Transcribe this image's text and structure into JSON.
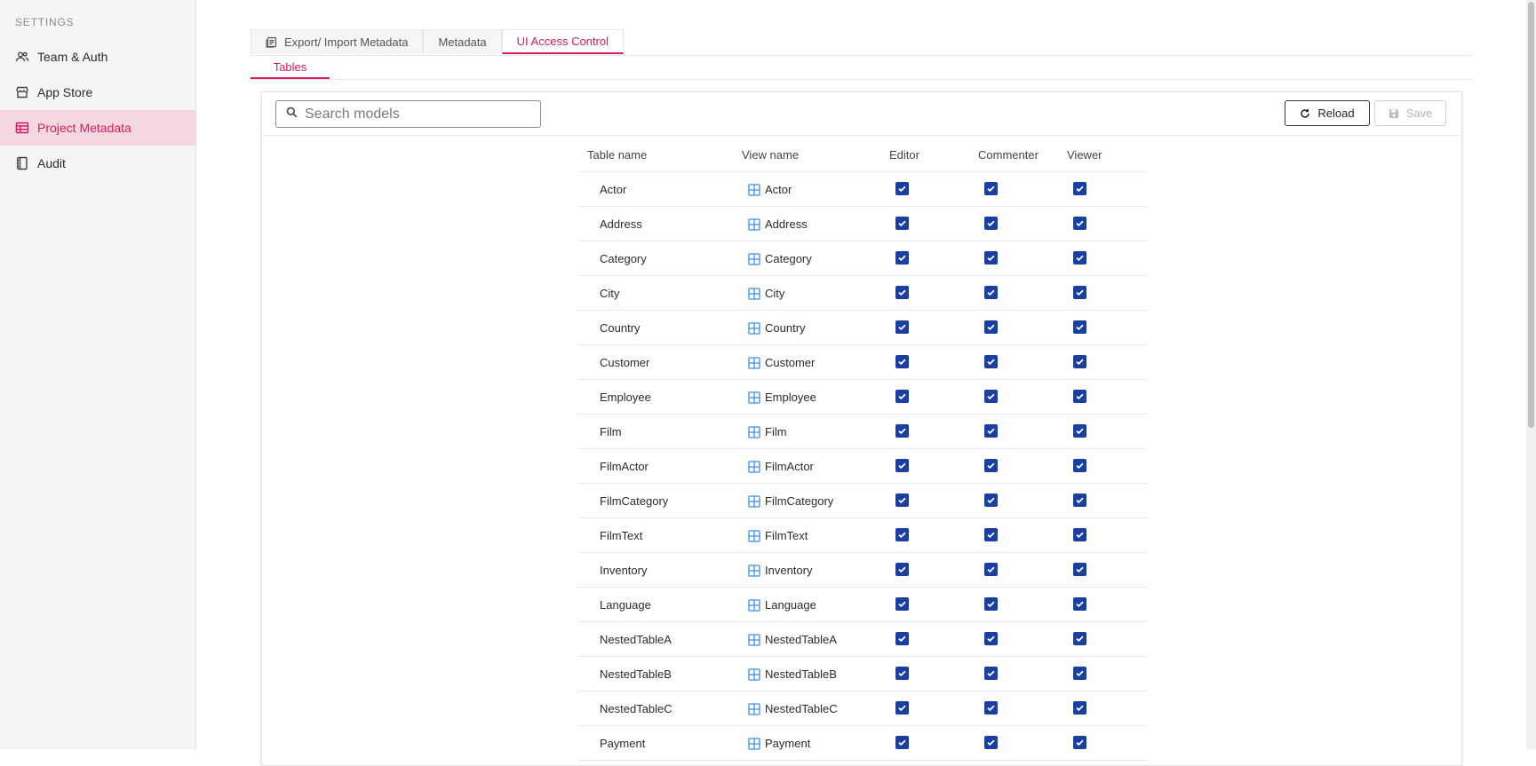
{
  "sidebar": {
    "heading": "SETTINGS",
    "items": [
      {
        "label": "Team & Auth",
        "icon": "users-icon",
        "active": false
      },
      {
        "label": "App Store",
        "icon": "store-icon",
        "active": false
      },
      {
        "label": "Project Metadata",
        "icon": "table-icon",
        "active": true
      },
      {
        "label": "Audit",
        "icon": "notebook-icon",
        "active": false
      }
    ]
  },
  "tabs": [
    {
      "label": "Export/ Import Metadata",
      "icon": "export-icon",
      "active": false
    },
    {
      "label": "Metadata",
      "active": false
    },
    {
      "label": "UI Access Control",
      "active": true
    }
  ],
  "subtab": {
    "label": "Tables"
  },
  "toolbar": {
    "search_placeholder": "Search models",
    "reload_label": "Reload",
    "save_label": "Save"
  },
  "table": {
    "headers": {
      "table_name": "Table name",
      "view_name": "View name",
      "editor": "Editor",
      "commenter": "Commenter",
      "viewer": "Viewer"
    },
    "rows": [
      {
        "table": "Actor",
        "view": "Actor",
        "editor": true,
        "commenter": true,
        "viewer": true
      },
      {
        "table": "Address",
        "view": "Address",
        "editor": true,
        "commenter": true,
        "viewer": true
      },
      {
        "table": "Category",
        "view": "Category",
        "editor": true,
        "commenter": true,
        "viewer": true
      },
      {
        "table": "City",
        "view": "City",
        "editor": true,
        "commenter": true,
        "viewer": true
      },
      {
        "table": "Country",
        "view": "Country",
        "editor": true,
        "commenter": true,
        "viewer": true
      },
      {
        "table": "Customer",
        "view": "Customer",
        "editor": true,
        "commenter": true,
        "viewer": true
      },
      {
        "table": "Employee",
        "view": "Employee",
        "editor": true,
        "commenter": true,
        "viewer": true
      },
      {
        "table": "Film",
        "view": "Film",
        "editor": true,
        "commenter": true,
        "viewer": true
      },
      {
        "table": "FilmActor",
        "view": "FilmActor",
        "editor": true,
        "commenter": true,
        "viewer": true
      },
      {
        "table": "FilmCategory",
        "view": "FilmCategory",
        "editor": true,
        "commenter": true,
        "viewer": true
      },
      {
        "table": "FilmText",
        "view": "FilmText",
        "editor": true,
        "commenter": true,
        "viewer": true
      },
      {
        "table": "Inventory",
        "view": "Inventory",
        "editor": true,
        "commenter": true,
        "viewer": true
      },
      {
        "table": "Language",
        "view": "Language",
        "editor": true,
        "commenter": true,
        "viewer": true
      },
      {
        "table": "NestedTableA",
        "view": "NestedTableA",
        "editor": true,
        "commenter": true,
        "viewer": true
      },
      {
        "table": "NestedTableB",
        "view": "NestedTableB",
        "editor": true,
        "commenter": true,
        "viewer": true
      },
      {
        "table": "NestedTableC",
        "view": "NestedTableC",
        "editor": true,
        "commenter": true,
        "viewer": true
      },
      {
        "table": "Payment",
        "view": "Payment",
        "editor": true,
        "commenter": true,
        "viewer": true
      }
    ]
  },
  "colors": {
    "accent": "#d81b60",
    "checkbox": "#1b3fa0",
    "grid_icon": "#3d8ee8"
  }
}
